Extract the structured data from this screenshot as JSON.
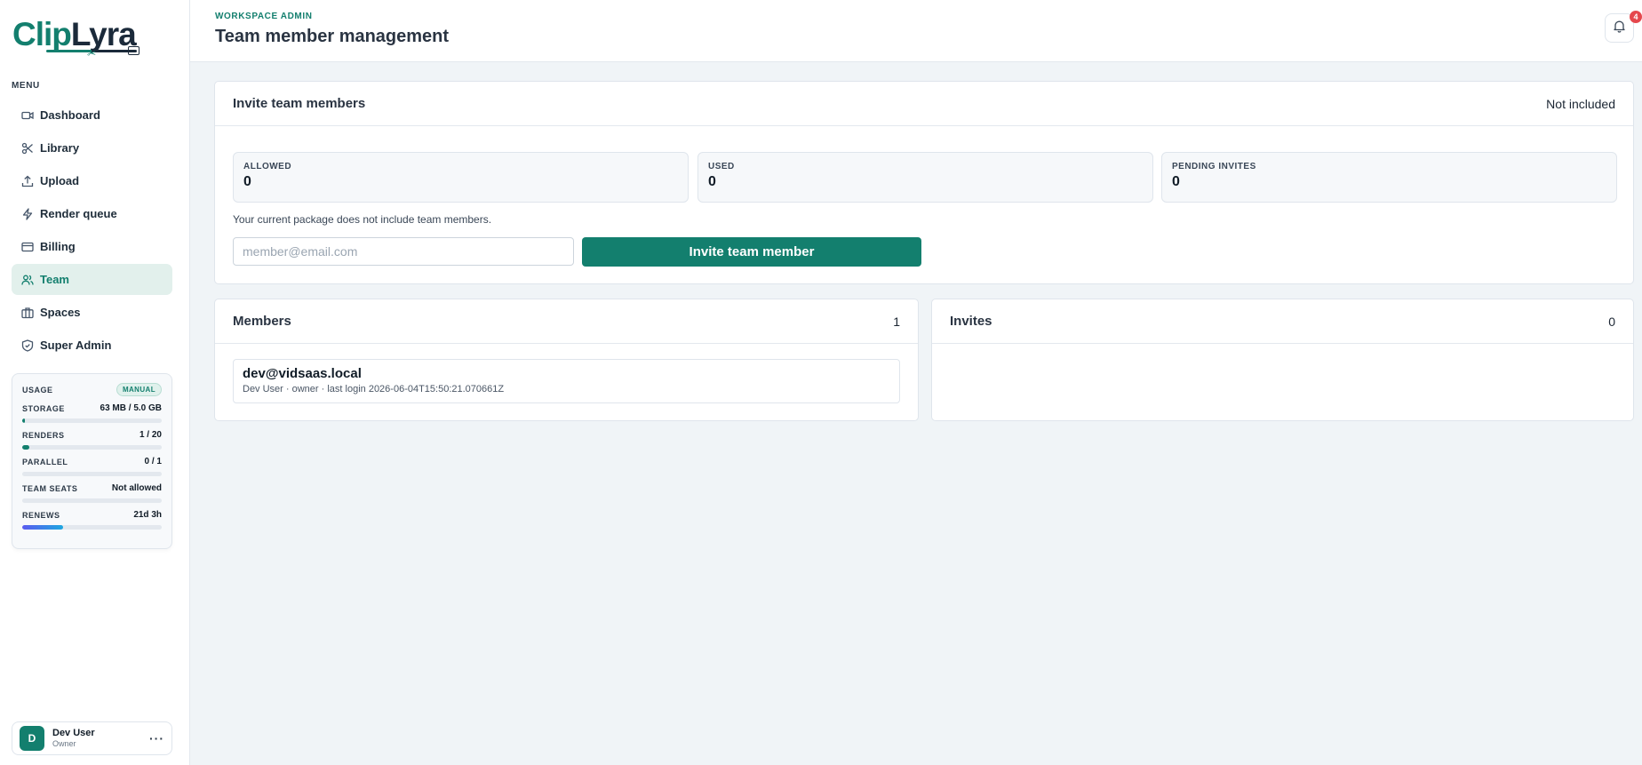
{
  "brand": {
    "part1": "Clip",
    "part2": "Lyra"
  },
  "sidebar": {
    "menu_heading": "MENU",
    "items": [
      {
        "label": "Dashboard",
        "icon": "video-icon",
        "active": false
      },
      {
        "label": "Library",
        "icon": "scissors-icon",
        "active": false
      },
      {
        "label": "Upload",
        "icon": "upload-icon",
        "active": false
      },
      {
        "label": "Render queue",
        "icon": "lightning-icon",
        "active": false
      },
      {
        "label": "Billing",
        "icon": "credit-card-icon",
        "active": false
      },
      {
        "label": "Team",
        "icon": "users-icon",
        "active": true
      },
      {
        "label": "Spaces",
        "icon": "briefcase-icon",
        "active": false
      },
      {
        "label": "Super Admin",
        "icon": "shield-icon",
        "active": false
      }
    ],
    "usage": {
      "title": "USAGE",
      "badge": "MANUAL",
      "rows": [
        {
          "label": "STORAGE",
          "value": "63 MB / 5.0 GB",
          "fraction": 0.012
        },
        {
          "label": "RENDERS",
          "value": "1 / 20",
          "fraction": 0.05
        },
        {
          "label": "PARALLEL",
          "value": "0 / 1",
          "fraction": 0
        },
        {
          "label": "TEAM SEATS",
          "value": "Not allowed",
          "fraction": 0
        },
        {
          "label": "RENEWS",
          "value": "21d 3h",
          "fraction": 0.29
        }
      ]
    },
    "user": {
      "initial": "D",
      "name": "Dev User",
      "role": "Owner",
      "more": "···"
    }
  },
  "header": {
    "eyebrow": "WORKSPACE ADMIN",
    "title": "Team member management",
    "notification_count": "4"
  },
  "invite": {
    "title": "Invite team members",
    "status": "Not included",
    "stats": [
      {
        "label": "ALLOWED",
        "value": "0"
      },
      {
        "label": "USED",
        "value": "0"
      },
      {
        "label": "PENDING INVITES",
        "value": "0"
      }
    ],
    "help_text": "Your current package does not include team members.",
    "email_placeholder": "member@email.com",
    "button_label": "Invite team member"
  },
  "members": {
    "title": "Members",
    "count": "1",
    "items": [
      {
        "email": "dev@vidsaas.local",
        "detail": "Dev User · owner · last login 2026-06-04T15:50:21.070661Z"
      }
    ]
  },
  "invites": {
    "title": "Invites",
    "count": "0"
  },
  "colors": {
    "accent": "#137f6e",
    "badge": "#e5484d"
  }
}
